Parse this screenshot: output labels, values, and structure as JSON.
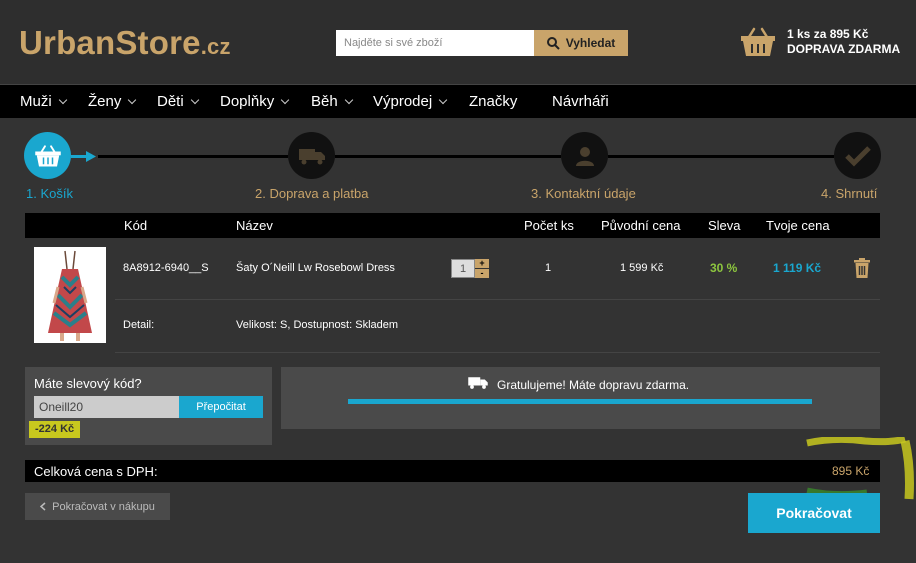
{
  "header": {
    "logo_main": "UrbanStore",
    "logo_tld": ".cz",
    "search": {
      "placeholder": "Najděte si své zboží",
      "button_label": "Vyhledat"
    },
    "cart": {
      "line1_prefix": "1 ks za ",
      "line1_amount": "895 Kč",
      "line2": "DOPRAVA ZDARMA"
    }
  },
  "nav": {
    "items": [
      "Muži",
      "Ženy",
      "Děti",
      "Doplňky",
      "Běh",
      "Výprodej",
      "Značky",
      "Návrháři"
    ]
  },
  "steps": [
    {
      "label": "1. Košík",
      "icon": "basket-icon",
      "active": true
    },
    {
      "label": "2. Doprava a platba",
      "icon": "truck-icon",
      "active": false
    },
    {
      "label": "3. Kontaktní údaje",
      "icon": "user-icon",
      "active": false
    },
    {
      "label": "4. Shrnutí",
      "icon": "check-icon",
      "active": false
    }
  ],
  "table": {
    "headers": {
      "code": "Kód",
      "name": "Název",
      "qty": "Počet ks",
      "orig_price": "Původní cena",
      "discount": "Sleva",
      "your_price": "Tvoje cena"
    },
    "item": {
      "code": "8A8912-6940__S",
      "name": "Šaty O´Neill Lw Rosebowl Dress",
      "qty_input": "1",
      "qty": "1",
      "orig_price": "1 599 Kč",
      "discount": "30 %",
      "your_price": "1 119 Kč",
      "detail_label": "Detail:",
      "detail_value": "Velikost: S, Dostupnost: Skladem"
    }
  },
  "coupon": {
    "title": "Máte slevový kód?",
    "value": "Oneill20",
    "button_label": "Přepočitat",
    "discount": "-224 Kč"
  },
  "shipping": {
    "message": "Gratulujeme! Máte dopravu zdarma.",
    "progress": 1.0
  },
  "total": {
    "label": "Celková cena s DPH:",
    "value": "895 Kč"
  },
  "buttons": {
    "back": "Pokračovat v nákupu",
    "continue": "Pokračovat"
  },
  "colors": {
    "accent_gold": "#c9a46a",
    "accent_blue": "#1aa7cf",
    "discount_green": "#8dc63f"
  }
}
